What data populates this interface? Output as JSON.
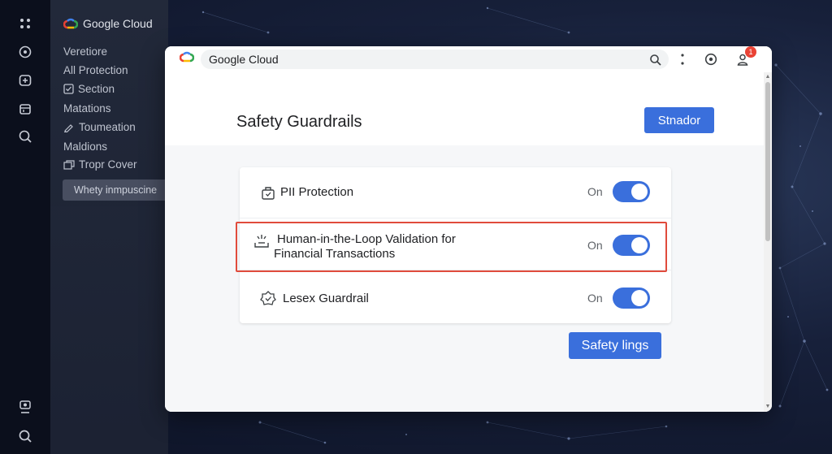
{
  "nav": {
    "brand": "Google Cloud",
    "items": [
      {
        "label": "Veretiore",
        "icon": ""
      },
      {
        "label": "All Protection",
        "icon": ""
      },
      {
        "label": "Section",
        "icon": "checkbox-icon"
      },
      {
        "label": "Matations",
        "icon": ""
      },
      {
        "label": "Toumeation",
        "icon": "pencil-icon"
      },
      {
        "label": "Maldions",
        "icon": ""
      },
      {
        "label": "Tropr Cover",
        "icon": "window-icon"
      }
    ],
    "active_item": "Whety inmpuscine"
  },
  "window": {
    "address_text": "Google Cloud",
    "notification_count": "1",
    "page_title": "Safety Guardrails",
    "top_button": "Stnador",
    "bottom_button": "Safety lings",
    "guardrails": [
      {
        "label": "PII Protection",
        "state": "On",
        "enabled": true,
        "icon": "shield-bag-icon"
      },
      {
        "label_line1": "Human-in-the-Loop Validation for",
        "label_line2": "Financial Transactions",
        "state": "On",
        "enabled": true,
        "icon": "spark-tray-icon"
      },
      {
        "label": "Lesex Guardrail",
        "state": "On",
        "enabled": true,
        "icon": "gear-check-icon"
      }
    ]
  },
  "colors": {
    "accent": "#3a6fdc",
    "highlight": "#e04b3c"
  }
}
